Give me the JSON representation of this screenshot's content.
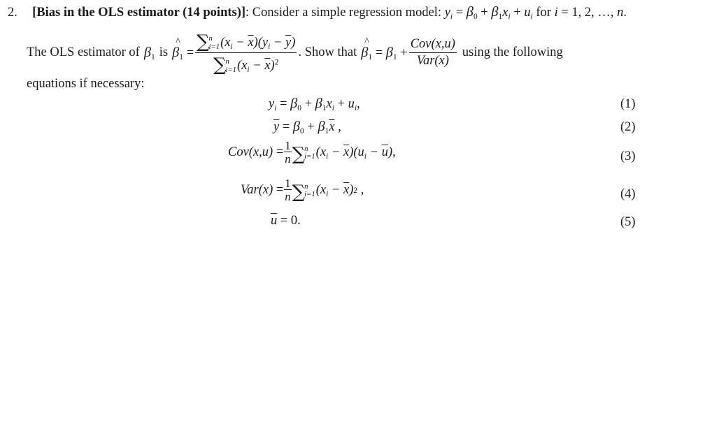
{
  "problem": {
    "number": "2.",
    "title": "[Bias in the OLS estimator (14 points)]",
    "intro": ": Consider a simple regression model: ",
    "model_lhs": "y",
    "model_for": "for",
    "model_index": "i = 1, 2, …, n.",
    "line2_prefix": "The OLS estimator of",
    "line2_is": "is",
    "line2_show": ". Show that",
    "line2_suffix": "using the following",
    "line3": "equations if necessary:"
  },
  "estimator": {
    "numerator": "(x_i − x̄)(y_i − ȳ)",
    "denominator": "(x_i − x̄)^2",
    "show_frac_num": "Cov(x,u)",
    "show_frac_den": "Var(x)"
  },
  "equations": [
    {
      "label": "(1)",
      "text": "y_i = β_0 + β_1 x_i + u_i,"
    },
    {
      "label": "(2)",
      "text": "ȳ = β_0 + β_1 x̄,"
    },
    {
      "label": "(3)",
      "text": "Cov(x,u) = (1/n) Σ_{i=1}^{n} (x_i − x̄)(u_i − ū),"
    },
    {
      "label": "(4)",
      "text": "Var(x) = (1/n) Σ_{i=1}^{n} (x_i − x̄)^2,"
    },
    {
      "label": "(5)",
      "text": "ū = 0."
    }
  ]
}
